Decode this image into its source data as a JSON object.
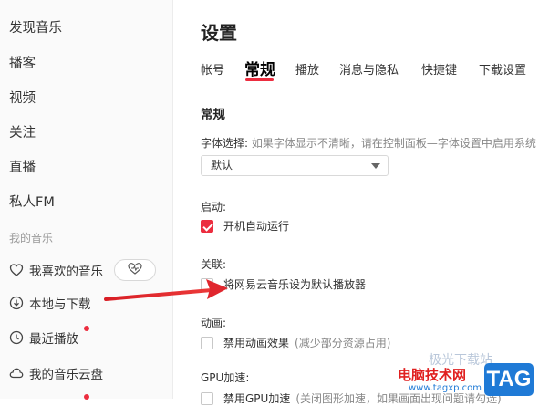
{
  "sidebar": {
    "nav": [
      {
        "label": "发现音乐"
      },
      {
        "label": "播客"
      },
      {
        "label": "视频"
      },
      {
        "label": "关注"
      },
      {
        "label": "直播"
      },
      {
        "label": "私人FM"
      }
    ],
    "section_label": "我的音乐",
    "my_music": [
      {
        "label": "我喜欢的音乐",
        "icon": "heart-icon"
      },
      {
        "label": "本地与下载",
        "icon": "download-icon"
      },
      {
        "label": "最近播放",
        "icon": "clock-icon"
      },
      {
        "label": "我的音乐云盘",
        "icon": "cloud-icon"
      }
    ]
  },
  "main": {
    "title": "设置",
    "tabs": [
      {
        "label": "帐号"
      },
      {
        "label": "常规",
        "active": true
      },
      {
        "label": "播放"
      },
      {
        "label": "消息与隐私"
      },
      {
        "label": "快捷键"
      },
      {
        "label": "下载设置"
      }
    ],
    "section_title": "常规",
    "font": {
      "label": "字体选择:",
      "hint": "如果字体显示不清晰，请在控制面板—字体设置中启用系统",
      "selected": "默认"
    },
    "startup": {
      "label": "启动:",
      "option": "开机自动运行",
      "checked": true
    },
    "association": {
      "label": "关联:",
      "option": "将网易云音乐设为默认播放器",
      "checked": false
    },
    "animation": {
      "label": "动画:",
      "option": "禁用动画效果",
      "note": "(减少部分资源占用)",
      "checked": false
    },
    "gpu": {
      "label": "GPU加速:",
      "option": "禁用GPU加速",
      "note": "(关闭图形加速，如果画面出现问题请勾选)",
      "checked": false
    }
  },
  "watermark": {
    "text": "电脑技术网",
    "logo": "TAG",
    "url": "www.tagxp.com",
    "faint": "极光下载站"
  },
  "colors": {
    "accent": "#ec2d3f",
    "annotation_arrow": "#e0262e",
    "sidebar_bg": "#fafafa"
  }
}
